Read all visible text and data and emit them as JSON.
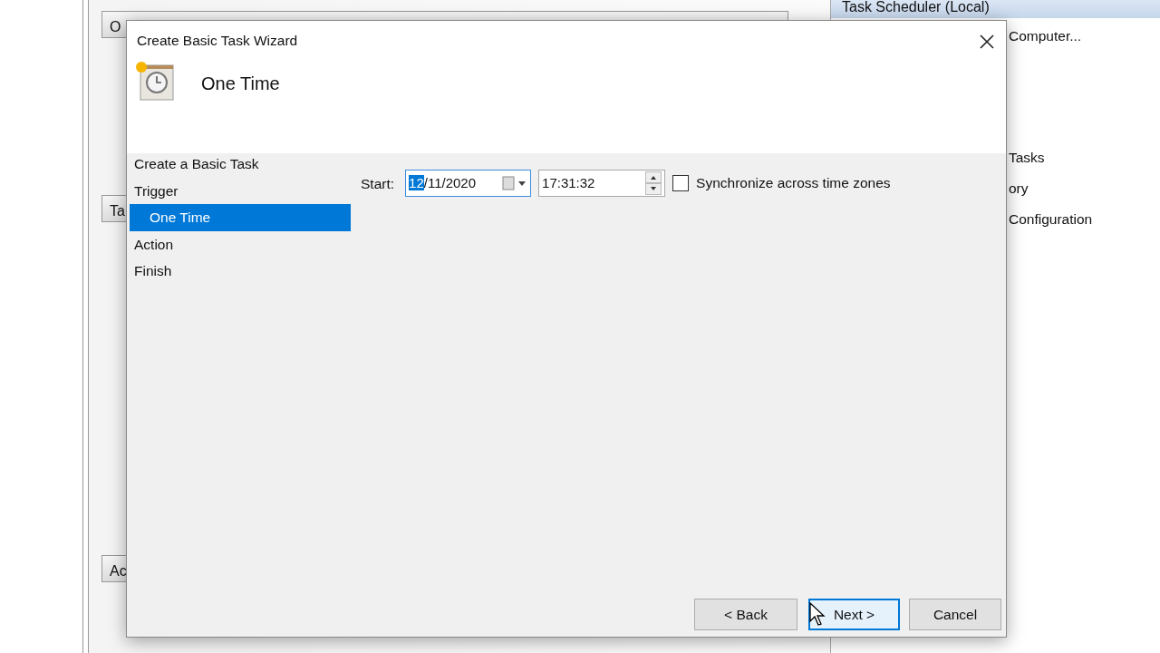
{
  "background": {
    "pane_tabs": [
      "O",
      "Ta",
      "Ac"
    ],
    "actions_header": "Task Scheduler (Local)",
    "actions": [
      "Computer...",
      "Tasks",
      "ory",
      "Configuration"
    ]
  },
  "dialog": {
    "title": "Create Basic Task Wizard",
    "heading": "One Time",
    "steps": [
      {
        "label": "Create a Basic Task",
        "selected": false
      },
      {
        "label": "Trigger",
        "selected": false,
        "children": [
          {
            "label": "One Time",
            "selected": true
          }
        ]
      },
      {
        "label": "Action",
        "selected": false
      },
      {
        "label": "Finish",
        "selected": false
      }
    ],
    "start": {
      "label": "Start:",
      "focused": true,
      "date_parts": [
        {
          "text": "12",
          "selected": true
        },
        {
          "text": "/11/2020",
          "selected": false
        }
      ],
      "time": "17:31:32"
    },
    "sync": {
      "label": "Synchronize across time zones",
      "checked": false
    },
    "buttons": [
      {
        "label": "< Back",
        "kind": "normal"
      },
      {
        "label": "Next >",
        "kind": "default"
      },
      {
        "label": "Cancel",
        "kind": "normal"
      }
    ]
  }
}
